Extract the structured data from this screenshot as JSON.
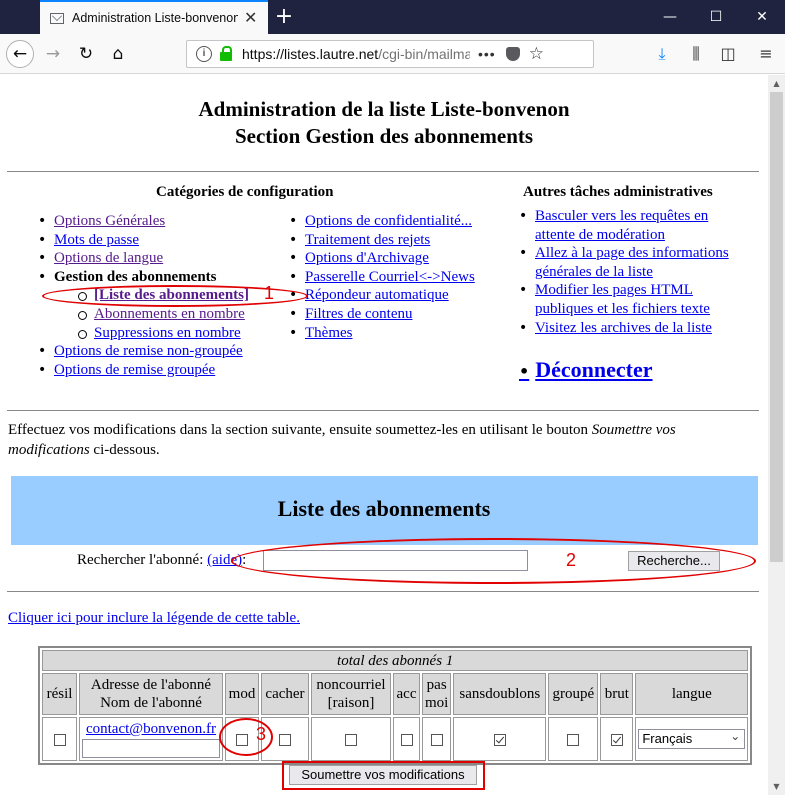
{
  "browser": {
    "tab_title": "Administration Liste-bonvenon",
    "new_tab": "+",
    "url_domain": "https://listes.lautre.net",
    "url_path": "/cgi-bin/mailma",
    "page_actions": "•••"
  },
  "page": {
    "title_line1": "Administration de la liste Liste-bonvenon",
    "title_line2": "Section Gestion des abonnements"
  },
  "categories": {
    "title": "Catégories de configuration",
    "col1": [
      {
        "label": "Options Générales",
        "visited": true
      },
      {
        "label": "Mots de passe",
        "visited": false
      },
      {
        "label": "Options de langue",
        "visited": true
      },
      {
        "label": "Gestion des abonnements",
        "current": true
      },
      {
        "label": "[Liste des abonnements]",
        "sub": true,
        "visited": true,
        "active": true
      },
      {
        "label": "Abonnements en nombre",
        "sub": true,
        "visited": true
      },
      {
        "label": "Suppressions en nombre",
        "sub": true,
        "visited": false
      },
      {
        "label": "Options de remise non-groupée",
        "visited": false
      },
      {
        "label": "Options de remise groupée",
        "visited": false
      }
    ],
    "col2": [
      {
        "label": "Options de confidentialité..."
      },
      {
        "label": "Traitement des rejets"
      },
      {
        "label": "Options d'Archivage"
      },
      {
        "label": "Passerelle Courriel<->News"
      },
      {
        "label": "Répondeur automatique"
      },
      {
        "label": "Filtres de contenu"
      },
      {
        "label": "Thèmes"
      }
    ]
  },
  "other_tasks": {
    "title": "Autres tâches administratives",
    "items": [
      "Basculer vers les requêtes en attente de modération",
      "Allez à la page des informations générales de la liste",
      "Modifier les pages HTML publiques et les fichiers texte",
      "Visitez les archives de la liste"
    ],
    "logout": "Déconnecter"
  },
  "instructions": {
    "text_before": "Effectuez vos modifications dans la section suivante, ensuite soumettez-les en utilisant le bouton ",
    "emphasis": "Soumettre vos modifications",
    "text_after": " ci-dessous."
  },
  "members": {
    "section_title": "Liste des abonnements",
    "search_label": "Rechercher l'abonné: ",
    "search_help_link": "(aide)",
    "search_colon": ":",
    "search_value": "",
    "search_button": "Recherche...",
    "legend_link": "Cliquer ici pour inclure la légende de cette table.",
    "total_label": "total des abonnés 1",
    "headers": {
      "unsub": "résil",
      "address_line1": "Adresse de l'abonné",
      "address_line2": "Nom de l'abonné",
      "mod": "mod",
      "hide": "cacher",
      "nomail_line1": "noncourriel",
      "nomail_line2": "[raison]",
      "ack": "acc",
      "notmetoo_line1": "pas",
      "notmetoo_line2": "moi",
      "nodupes": "sansdoublons",
      "digest": "groupé",
      "plain": "brut",
      "language": "langue"
    },
    "rows": [
      {
        "email": "contact@bonvenon.fr",
        "name": "",
        "unsub": false,
        "mod": false,
        "hide": false,
        "nomail": false,
        "ack": false,
        "notmetoo": false,
        "nodupes": true,
        "digest": false,
        "plain": true,
        "language": "Français"
      }
    ],
    "submit_button": "Soumettre vos modifications"
  },
  "annotations": {
    "color": "#e00000",
    "labels": [
      "1",
      "2",
      "3"
    ]
  }
}
